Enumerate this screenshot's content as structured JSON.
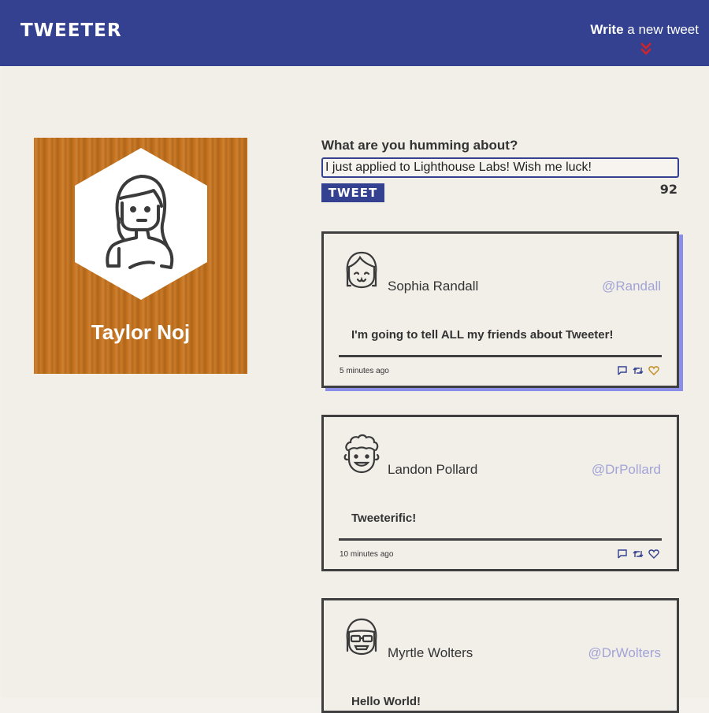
{
  "header": {
    "brand": "TWEETER",
    "write_bold": "Write",
    "write_rest": " a new tweet",
    "chevron_icon": "double-chevron-down-icon",
    "accent": "#334190",
    "chevron_color": "#d0242a"
  },
  "profile": {
    "name": "Taylor Noj",
    "avatar_icon": "girl-avatar-icon"
  },
  "compose": {
    "label": "What are you humming about?",
    "input_value": "I just applied to Lighthouse Labs! Wish me luck!",
    "button_label": "TWEET",
    "counter": "92"
  },
  "tweets": [
    {
      "name": "Sophia Randall",
      "handle": "@Randall",
      "content": "I'm going to tell ALL my friends about Tweeter!",
      "time": "5 minutes ago"
    },
    {
      "name": "Landon Pollard",
      "handle": "@DrPollard",
      "content": "Tweeterific!",
      "time": "10 minutes ago"
    },
    {
      "name": "Myrtle Wolters",
      "handle": "@DrWolters",
      "content": "Hello World!",
      "time": ""
    }
  ]
}
